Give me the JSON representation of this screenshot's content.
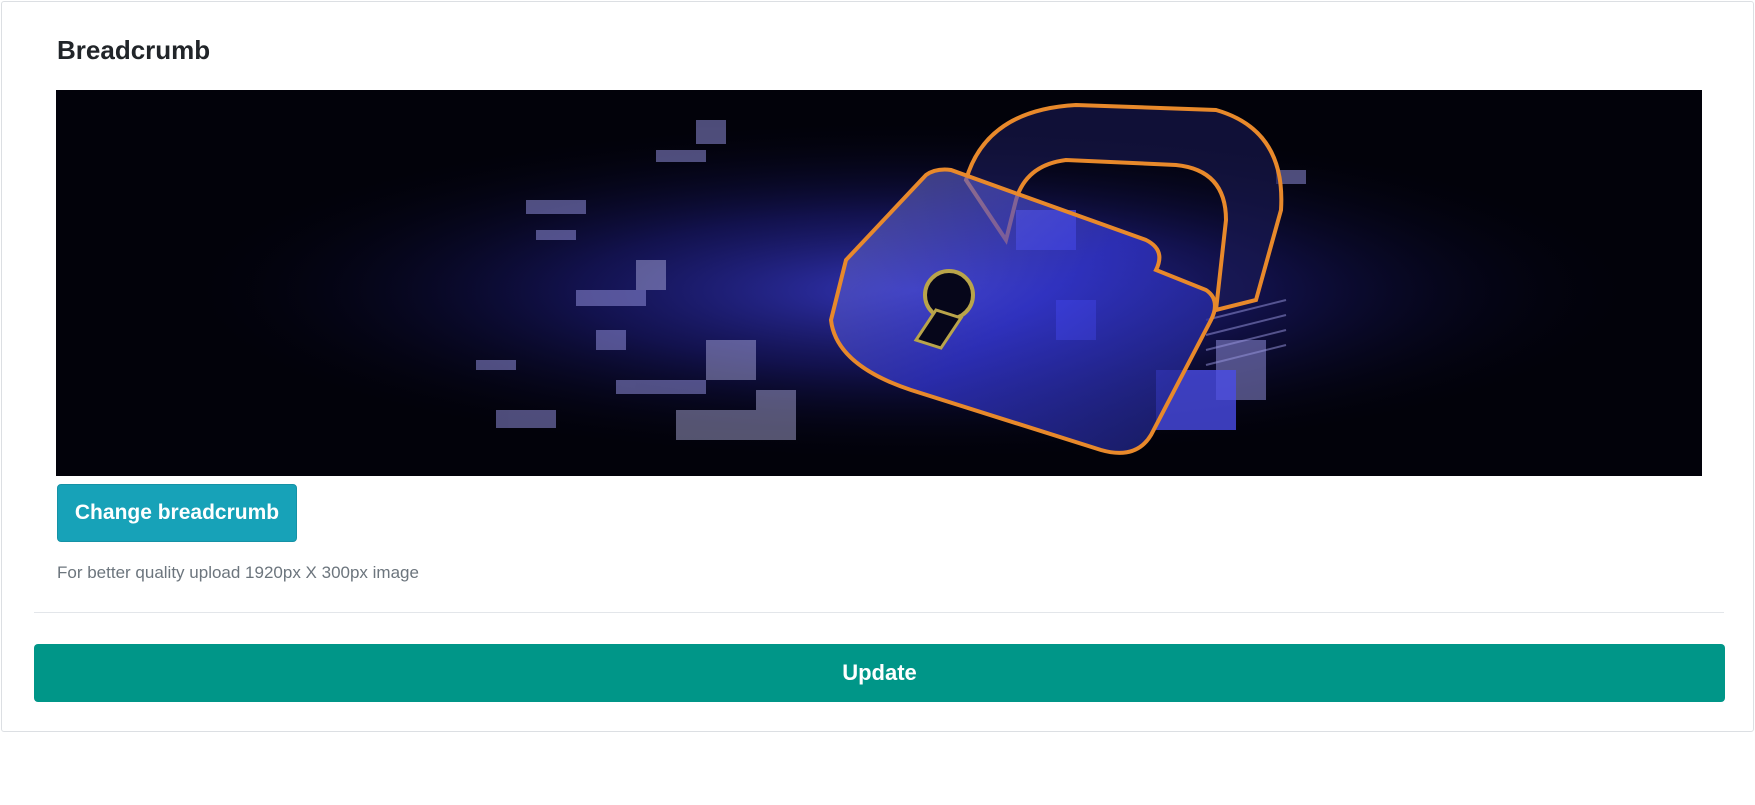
{
  "card": {
    "title": "Breadcrumb",
    "banner_image": "padlock-circuit-board-image",
    "change_button_label": "Change breadcrumb",
    "hint_text": "For better quality upload 1920px X 300px image",
    "update_button_label": "Update"
  },
  "colors": {
    "change_button": "#17a2b8",
    "update_button": "#009688",
    "banner_background": "#02020a",
    "padlock_outline": "#e8892b",
    "circuit_glow": "#3a3cff"
  }
}
